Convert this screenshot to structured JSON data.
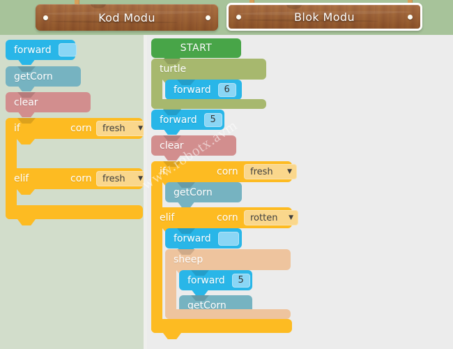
{
  "header": {
    "tabs": [
      {
        "id": "kod",
        "label": "Kod Modu",
        "active": false
      },
      {
        "id": "blok",
        "label": "Blok Modu",
        "active": true
      }
    ]
  },
  "palette": {
    "title": "block-palette",
    "blocks": [
      {
        "name": "forward",
        "label": "forward",
        "kind": "value",
        "value": ""
      },
      {
        "name": "getCorn",
        "label": "getCorn",
        "kind": "simple"
      },
      {
        "name": "clear",
        "label": "clear",
        "kind": "simple"
      },
      {
        "name": "if",
        "label": "if",
        "kind": "conditional",
        "variable": "corn",
        "state": "fresh"
      },
      {
        "name": "elif",
        "label": "elif",
        "kind": "conditional",
        "variable": "corn",
        "state": "fresh"
      }
    ],
    "dropdown_arrow": "▼"
  },
  "workspace": {
    "start_label": "START",
    "program": [
      {
        "name": "turtle",
        "label": "turtle",
        "kind": "wrapper",
        "children": [
          {
            "name": "forward",
            "label": "forward",
            "value": "6"
          }
        ]
      },
      {
        "name": "forward",
        "label": "forward",
        "value": "5"
      },
      {
        "name": "clear",
        "label": "clear"
      },
      {
        "name": "if",
        "label": "if",
        "variable": "corn",
        "state": "fresh",
        "children": [
          {
            "name": "getCorn",
            "label": "getCorn"
          }
        ]
      },
      {
        "name": "elif",
        "label": "elif",
        "variable": "corn",
        "state": "rotten",
        "children": [
          {
            "name": "forward",
            "label": "forward",
            "value": ""
          },
          {
            "name": "sheep",
            "label": "sheep",
            "kind": "wrapper",
            "children": [
              {
                "name": "forward",
                "label": "forward",
                "value": "5"
              },
              {
                "name": "getCorn",
                "label": "getCorn"
              }
            ]
          }
        ]
      }
    ],
    "dropdown_arrow": "▼",
    "watermark": "www.robotx.avm"
  },
  "colors": {
    "header_bg": "#a7c39a",
    "plank": "#9d5c2e",
    "palette_bg": "#d2ddcb",
    "workspace_bg": "#ececec",
    "forward": "#29b6e8",
    "getcorn": "#76b3c1",
    "clear": "#d28e8e",
    "control": "#fdbb22",
    "start": "#48a548",
    "turtle": "#a7b86e",
    "sheep": "#eec49e",
    "slot": "#8ad6f5",
    "dropdown": "#fad78c"
  }
}
